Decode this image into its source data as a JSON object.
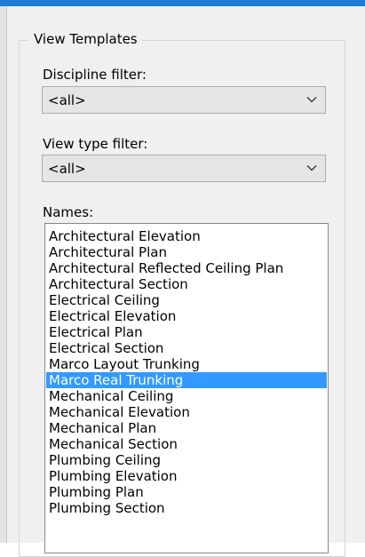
{
  "accent_color": "#1e7bd4",
  "selection_color": "#3399ff",
  "group": {
    "title": "View Templates"
  },
  "discipline_filter": {
    "label": "Discipline filter:",
    "value": "<all>"
  },
  "view_type_filter": {
    "label": "View type filter:",
    "value": "<all>"
  },
  "names": {
    "label": "Names:",
    "selected": "Marco Real Trunking",
    "items": [
      "Architectural Elevation",
      "Architectural Plan",
      "Architectural Reflected Ceiling Plan",
      "Architectural Section",
      "Electrical Ceiling",
      "Electrical Elevation",
      "Electrical Plan",
      "Electrical Section",
      "Marco Layout Trunking",
      "Marco Real Trunking",
      "Mechanical Ceiling",
      "Mechanical Elevation",
      "Mechanical Plan",
      "Mechanical Section",
      "Plumbing Ceiling",
      "Plumbing Elevation",
      "Plumbing Plan",
      "Plumbing Section"
    ]
  }
}
